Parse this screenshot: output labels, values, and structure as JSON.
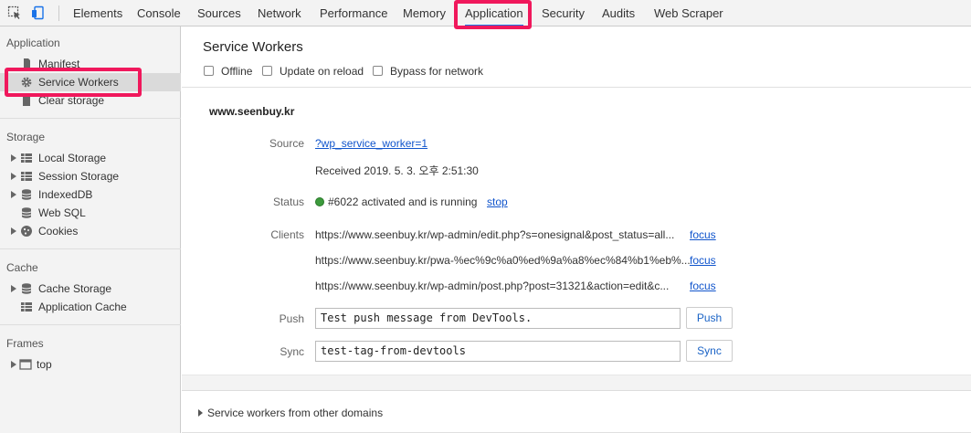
{
  "toolbar": {
    "tabs": [
      "Elements",
      "Console",
      "Sources",
      "Network",
      "Performance",
      "Memory",
      "Application",
      "Security",
      "Audits",
      "Web Scraper"
    ],
    "active_tab": "Application",
    "icons": [
      "inspect-element-icon",
      "device-toolbar-icon"
    ]
  },
  "sidebar": {
    "sections": [
      {
        "title": "Application",
        "items": [
          {
            "label": "Manifest",
            "icon": "file-icon"
          },
          {
            "label": "Service Workers",
            "icon": "gear-icon",
            "selected": true
          },
          {
            "label": "Clear storage",
            "icon": "trash-icon"
          }
        ]
      },
      {
        "title": "Storage",
        "items": [
          {
            "label": "Local Storage",
            "icon": "grid-icon"
          },
          {
            "label": "Session Storage",
            "icon": "grid-icon"
          },
          {
            "label": "IndexedDB",
            "icon": "database-icon"
          },
          {
            "label": "Web SQL",
            "icon": "database-icon"
          },
          {
            "label": "Cookies",
            "icon": "cookie-icon"
          }
        ]
      },
      {
        "title": "Cache",
        "items": [
          {
            "label": "Cache Storage",
            "icon": "database-icon"
          },
          {
            "label": "Application Cache",
            "icon": "grid-icon"
          }
        ]
      },
      {
        "title": "Frames",
        "items": [
          {
            "label": "top",
            "icon": "frame-icon"
          }
        ]
      }
    ]
  },
  "main": {
    "title": "Service Workers",
    "options": [
      "Offline",
      "Update on reload",
      "Bypass for network"
    ],
    "worker": {
      "domain": "www.seenbuy.kr",
      "source_label": "Source",
      "source_link": "?wp_service_worker=1",
      "received": "Received 2019. 5. 3. 오후 2:51:30",
      "status_label": "Status",
      "status_text": "#6022 activated and is running",
      "status_action": "stop",
      "clients_label": "Clients",
      "clients": [
        {
          "url": "https://www.seenbuy.kr/wp-admin/edit.php?s=onesignal&post_status=all...",
          "action": "focus"
        },
        {
          "url": "https://www.seenbuy.kr/pwa-%ec%9c%a0%ed%9a%a8%ec%84%b1%eb%...",
          "action": "focus"
        },
        {
          "url": "https://www.seenbuy.kr/wp-admin/post.php?post=31321&action=edit&c...",
          "action": "focus"
        }
      ],
      "push_label": "Push",
      "push_value": "Test push message from DevTools.",
      "push_button": "Push",
      "sync_label": "Sync",
      "sync_value": "test-tag-from-devtools",
      "sync_button": "Sync"
    },
    "other_domains": "Service workers from other domains"
  },
  "colors": {
    "highlight": "#f0185c",
    "link": "#1155cc",
    "status_running": "#3c9a3c"
  }
}
